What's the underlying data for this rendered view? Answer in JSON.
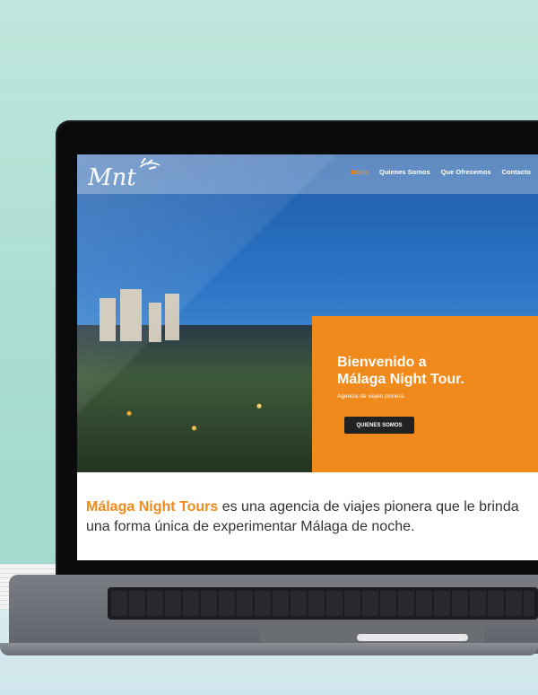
{
  "nav": {
    "items": [
      "Inicio",
      "Quienes Somos",
      "Que Ofrecemos",
      "Contacto"
    ],
    "active_index": 0
  },
  "hero": {
    "welcome_line1": "Bienvenido a",
    "welcome_line2": "Málaga Night Tour.",
    "tagline": "Agencia de viajes pionera.",
    "cta_label": "QUIENES SOMOS"
  },
  "intro": {
    "brand": "Málaga Night Tours",
    "text": " es una agencia de viajes pionera que le brinda una forma única de experimentar Málaga de noche."
  },
  "colors": {
    "accent": "#f08a1c",
    "dark_button": "#222222",
    "text": "#333333"
  },
  "logo": {
    "text": "Mnt"
  }
}
